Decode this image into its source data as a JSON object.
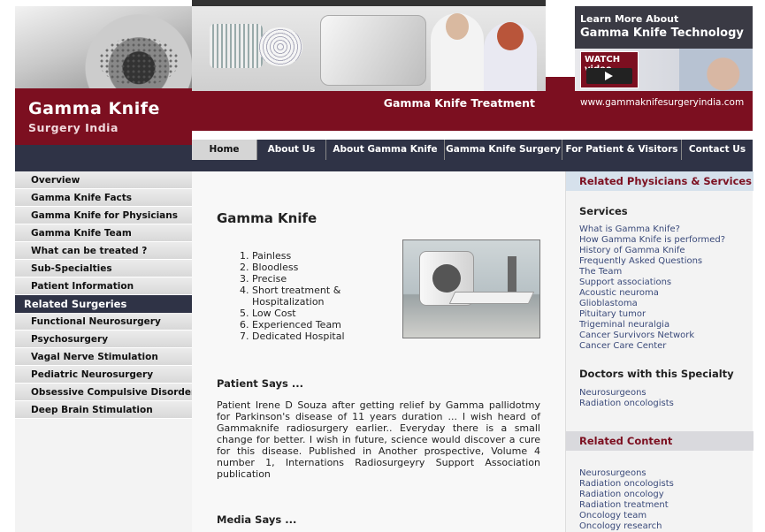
{
  "header": {
    "logo_title": "Gamma Knife",
    "logo_subtitle": "Surgery India",
    "treatment_label": "Gamma Knife Treatment",
    "learn_line1": "Learn More About",
    "learn_line2": "Gamma Knife Technology",
    "watch_label": "WATCH video",
    "url": "www.gammaknifesurgeryindia.com"
  },
  "nav": {
    "items": [
      {
        "label": "Home"
      },
      {
        "label": "About Us"
      },
      {
        "label": "About Gamma Knife"
      },
      {
        "label": "Gamma Knife Surgery"
      },
      {
        "label": "For Patient & Visitors"
      },
      {
        "label": "Contact Us"
      }
    ]
  },
  "sidebar": {
    "items": [
      {
        "label": "Overview"
      },
      {
        "label": "Gamma Knife Facts"
      },
      {
        "label": "Gamma Knife for Physicians"
      },
      {
        "label": "Gamma Knife Team"
      },
      {
        "label": "What can be treated ?"
      },
      {
        "label": "Sub-Specialties"
      },
      {
        "label": "Patient Information"
      }
    ],
    "related_header": "Related Surgeries",
    "related_items": [
      {
        "label": "Functional Neurosurgery"
      },
      {
        "label": "Psychosurgery"
      },
      {
        "label": "Vagal Nerve Stimulation"
      },
      {
        "label": "Pediatric Neurosurgery"
      },
      {
        "label": "Obsessive Compulsive Disorder"
      },
      {
        "label": "Deep Brain Stimulation"
      }
    ]
  },
  "main": {
    "title": "Gamma Knife",
    "features": [
      "Painless",
      "Bloodless",
      "Precise",
      "Short treatment & Hospitalization",
      "Low Cost",
      "Experienced Team",
      "Dedicated Hospital"
    ],
    "patient_heading": "Patient Says ...",
    "patient_quote": "Patient Irene D Souza after getting relief by Gamma pallidotmy for Parkinson's disease of 11 years duration ... I wish heard of Gammaknife radiosurgery earlier.. Everyday there is a small change for better. I wish in future, science would discover a cure for this disease. Published in Another prospective, Volume 4 number 1, Internations Radiosurgeyry Support Association publication",
    "media_heading": "Media Says ..."
  },
  "right": {
    "physicians_header": "Related Physicians & Services",
    "services_heading": "Services",
    "services": [
      "What is Gamma Knife?",
      "How Gamma Knife is performed?",
      "History of Gamma Knife",
      "Frequently Asked Questions",
      "The Team",
      "Support associations",
      "Acoustic neuroma",
      "Glioblastoma",
      "Pituitary tumor",
      "Trigeminal neuralgia",
      "Cancer Survivors Network",
      "Cancer Care Center"
    ],
    "doctors_heading": "Doctors with this Specialty",
    "doctors": [
      "Neurosurgeons",
      "Radiation oncologists"
    ],
    "content_header": "Related Content",
    "content_links": [
      "Neurosurgeons",
      "Radiation oncologists",
      "Radiation oncology",
      "Radiation treatment",
      "Oncology team",
      "Oncology research"
    ]
  },
  "colors": {
    "maroon": "#7c0f20",
    "navy": "#2f3346",
    "link": "#3a4a7a"
  }
}
